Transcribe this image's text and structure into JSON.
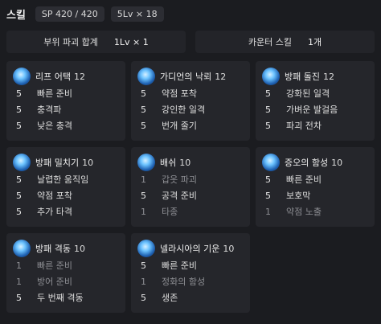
{
  "header": {
    "title": "스킬",
    "sp": "SP 420 / 420",
    "level": "5Lv × 18"
  },
  "summary": [
    {
      "label": "부위 파괴 합계",
      "value": "1Lv × 1"
    },
    {
      "label": "카운터 스킬",
      "value": "1개"
    }
  ],
  "skills": [
    {
      "name": "리프 어택",
      "level": "12",
      "options": [
        {
          "lv": "5",
          "name": "빠른 준비",
          "active": true
        },
        {
          "lv": "5",
          "name": "충격파",
          "active": true
        },
        {
          "lv": "5",
          "name": "낮은 충격",
          "active": true
        }
      ]
    },
    {
      "name": "가디언의 낙뢰",
      "level": "12",
      "options": [
        {
          "lv": "5",
          "name": "약점 포착",
          "active": true
        },
        {
          "lv": "5",
          "name": "강인한 일격",
          "active": true
        },
        {
          "lv": "5",
          "name": "번개 줄기",
          "active": true
        }
      ]
    },
    {
      "name": "방패 돌진",
      "level": "12",
      "options": [
        {
          "lv": "5",
          "name": "강화된 일격",
          "active": true
        },
        {
          "lv": "5",
          "name": "가벼운 발걸음",
          "active": true
        },
        {
          "lv": "5",
          "name": "파괴 전차",
          "active": true
        }
      ]
    },
    {
      "name": "방패 밀치기",
      "level": "10",
      "options": [
        {
          "lv": "5",
          "name": "날렵한 움직임",
          "active": true
        },
        {
          "lv": "5",
          "name": "약점 포착",
          "active": true
        },
        {
          "lv": "5",
          "name": "추가 타격",
          "active": true
        }
      ]
    },
    {
      "name": "배쉬",
      "level": "10",
      "options": [
        {
          "lv": "1",
          "name": "갑옷 파괴",
          "active": false
        },
        {
          "lv": "5",
          "name": "공격 준비",
          "active": true
        },
        {
          "lv": "1",
          "name": "타종",
          "active": false
        }
      ]
    },
    {
      "name": "증오의 함성",
      "level": "10",
      "options": [
        {
          "lv": "5",
          "name": "빠른 준비",
          "active": true
        },
        {
          "lv": "5",
          "name": "보호막",
          "active": true
        },
        {
          "lv": "1",
          "name": "약점 노출",
          "active": false
        }
      ]
    },
    {
      "name": "방패 격동",
      "level": "10",
      "options": [
        {
          "lv": "1",
          "name": "빠른 준비",
          "active": false
        },
        {
          "lv": "1",
          "name": "방어 준비",
          "active": false
        },
        {
          "lv": "5",
          "name": "두 번째 격동",
          "active": true
        }
      ]
    },
    {
      "name": "넬라시아의 기운",
      "level": "10",
      "options": [
        {
          "lv": "5",
          "name": "빠른 준비",
          "active": true
        },
        {
          "lv": "1",
          "name": "정화의 함성",
          "active": false
        },
        {
          "lv": "5",
          "name": "생존",
          "active": true
        }
      ]
    }
  ]
}
